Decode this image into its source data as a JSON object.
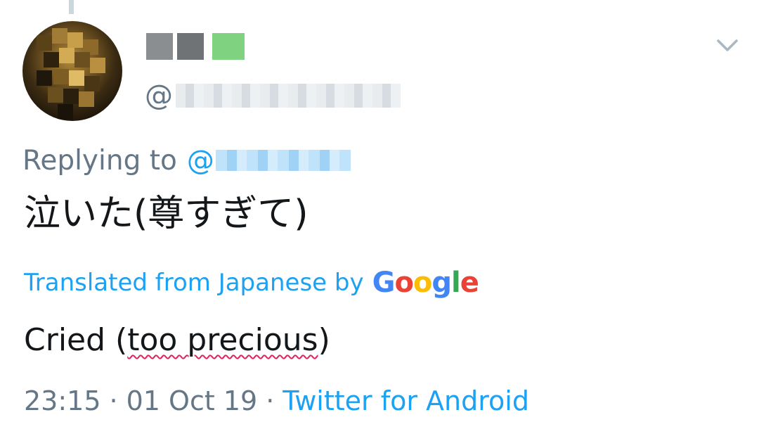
{
  "tweet": {
    "handle_prefix": "@",
    "reply": {
      "prefix": "Replying to",
      "handle_prefix": "@"
    },
    "text": "泣いた(尊すぎて)",
    "translation": {
      "label": "Translated from Japanese by",
      "brand_letters": [
        "G",
        "o",
        "o",
        "g",
        "l",
        "e"
      ],
      "brand_colors": [
        "#4285F4",
        "#EA4335",
        "#FBBC05",
        "#4285F4",
        "#34A853",
        "#EA4335"
      ],
      "text_open": "Cried (",
      "text_underlined": "too precious",
      "text_close": ")"
    },
    "timestamp": "23:15",
    "date": "01 Oct 19",
    "separator": "·",
    "source": "Twitter for Android"
  },
  "colors": {
    "accent": "#1da1f2",
    "secondary": "#657786",
    "text": "#14171a",
    "spellcheck": "#e0245e"
  },
  "icons": {
    "menu": "chevron-down-icon"
  }
}
